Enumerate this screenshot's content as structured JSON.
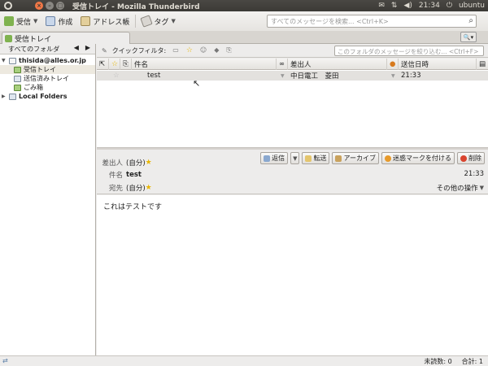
{
  "window": {
    "title": "受信トレイ - Mozilla Thunderbird"
  },
  "tray": {
    "clock": "21:34",
    "user": "ubuntu"
  },
  "toolbar": {
    "get_mail": "受信",
    "write": "作成",
    "address_book": "アドレス帳",
    "tag": "タグ",
    "search_placeholder": "すべてのメッセージを検索... <Ctrl+K>"
  },
  "tab": {
    "label": "受信トレイ"
  },
  "folder_pane": {
    "header": "すべてのフォルダ",
    "account": "thisida@alles.or.jp",
    "folders": [
      "受信トレイ",
      "送信済みトレイ",
      "ごみ箱"
    ],
    "local": "Local Folders"
  },
  "quick_filter": {
    "label": "クイックフィルタ:",
    "placeholder": "このフォルダのメッセージを絞り込む... <Ctrl+F>"
  },
  "thread_columns": {
    "subject": "件名",
    "from": "差出人",
    "date": "送信日時"
  },
  "messages": [
    {
      "subject": "test",
      "from": "中日電工　菱田",
      "date": "21:33"
    }
  ],
  "message_header": {
    "from_label": "差出人",
    "from_value": "(自分)",
    "subject_label": "件名",
    "subject_value": "test",
    "to_label": "宛先",
    "to_value": "(自分)",
    "time": "21:33",
    "other_actions": "その他の操作",
    "buttons": {
      "reply": "返信",
      "forward": "転送",
      "archive": "アーカイブ",
      "junk": "迷惑マークを付ける",
      "delete": "削除"
    }
  },
  "message_body": "これはテストです",
  "status": {
    "unread": "未読数: 0",
    "total": "合計: 1"
  }
}
